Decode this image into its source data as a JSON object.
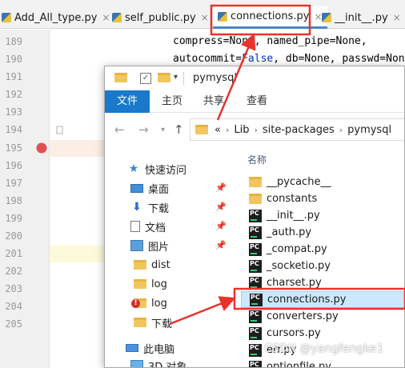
{
  "ide": {
    "tabs": [
      {
        "label": "Add_All_type.py"
      },
      {
        "label": "self_public.py"
      },
      {
        "label": "connections.py"
      },
      {
        "label": "__init__.py"
      }
    ],
    "line_numbers": [
      "189",
      "190",
      "191",
      "192",
      "193",
      "194",
      "195",
      "196",
      "197",
      "198",
      "199",
      "200",
      "201",
      "202",
      "203",
      "204",
      "205"
    ],
    "code_line_189": "compress=None, named_pipe=None,",
    "code_line_190_a": "autocommit=",
    "code_line_190_kw": "False",
    "code_line_190_b": ", db=None, passwd=Non"
  },
  "explorer": {
    "title": "pymysql",
    "ribbon_tabs": [
      "文件",
      "主页",
      "共享",
      "查看"
    ],
    "breadcrumb": [
      "«",
      "Lib",
      "site-packages",
      "pymysql"
    ],
    "quick_access": [
      {
        "label": "快速访问",
        "icon": "star-icon"
      },
      {
        "label": "桌面",
        "icon": "desktop-icon",
        "pinned": true
      },
      {
        "label": "下载",
        "icon": "download-icon",
        "pinned": true
      },
      {
        "label": "文档",
        "icon": "document-icon",
        "pinned": true
      },
      {
        "label": "图片",
        "icon": "picture-icon",
        "pinned": true
      },
      {
        "label": "dist",
        "icon": "folder-icon"
      },
      {
        "label": "log",
        "icon": "folder-icon"
      },
      {
        "label": "log",
        "icon": "folder-error-icon"
      },
      {
        "label": "下载",
        "icon": "folder-icon"
      },
      {
        "label": "此电脑",
        "icon": "computer-icon"
      },
      {
        "label": "3D 对象",
        "icon": "3d-objects-icon"
      }
    ],
    "column_header": "名称",
    "files": [
      {
        "name": "__pycache__",
        "type": "folder"
      },
      {
        "name": "constants",
        "type": "folder"
      },
      {
        "name": "__init__.py",
        "type": "py"
      },
      {
        "name": "_auth.py",
        "type": "py"
      },
      {
        "name": "_compat.py",
        "type": "py"
      },
      {
        "name": "_socketio.py",
        "type": "py"
      },
      {
        "name": "charset.py",
        "type": "py"
      },
      {
        "name": "connections.py",
        "type": "py",
        "selected": true
      },
      {
        "name": "converters.py",
        "type": "py"
      },
      {
        "name": "cursors.py",
        "type": "py"
      },
      {
        "name": "err.py",
        "type": "py"
      },
      {
        "name": "optionfile.py",
        "type": "py"
      }
    ]
  },
  "watermark": "CSDN @yangfengke1",
  "colors": {
    "accent": "#1979ca",
    "annotation_red": "#e8332c",
    "selection": "#cce8ff",
    "breakpoint": "#e05252"
  }
}
